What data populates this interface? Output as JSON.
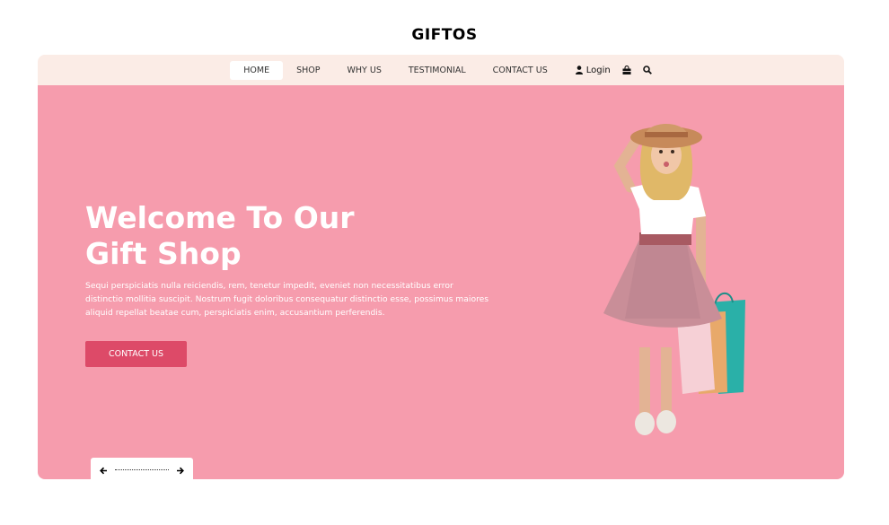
{
  "brand": {
    "name": "GIFTOS"
  },
  "nav": {
    "items": [
      {
        "label": "HOME",
        "active": true
      },
      {
        "label": "SHOP",
        "active": false
      },
      {
        "label": "WHY US",
        "active": false
      },
      {
        "label": "TESTIMONIAL",
        "active": false
      },
      {
        "label": "CONTACT US",
        "active": false
      }
    ],
    "login_label": "Login",
    "icons": [
      "user-icon",
      "shopping-bag-icon",
      "search-icon"
    ]
  },
  "hero": {
    "title_line1": "Welcome To Our",
    "title_line2": "Gift Shop",
    "description": "Sequi perspiciatis nulla reiciendis, rem, tenetur impedit, eveniet non necessitatibus error distinctio mollitia suscipit. Nostrum fugit doloribus consequatur distinctio esse, possimus maiores aliquid repellat beatae cum, perspiciatis enim, accusantium perferendis.",
    "button_label": "CONTACT US",
    "background_color": "#f69cad",
    "button_color": "#dd4a68",
    "image": "girl-with-shopping-bags"
  },
  "carousel": {
    "prev_icon": "arrow-left-icon",
    "next_icon": "arrow-right-icon"
  }
}
